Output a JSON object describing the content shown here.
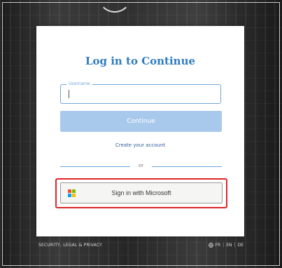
{
  "card": {
    "title": "Log in to Continue",
    "username": {
      "label": "Username",
      "value": ""
    },
    "continue_label": "Continue",
    "create_account": "Create your account",
    "divider_text": "or",
    "microsoft_button": "Sign in with Microsoft"
  },
  "microsoft_logo_colors": [
    "#f25022",
    "#7fba00",
    "#00a4ef",
    "#ffb900"
  ],
  "highlight_color": "#e0252b",
  "accent": "#2f7cc2",
  "footer": {
    "left_text": "SECURITY, LEGAL & PRIVACY",
    "languages": [
      "FR",
      "EN",
      "DE"
    ],
    "separator": "|"
  }
}
